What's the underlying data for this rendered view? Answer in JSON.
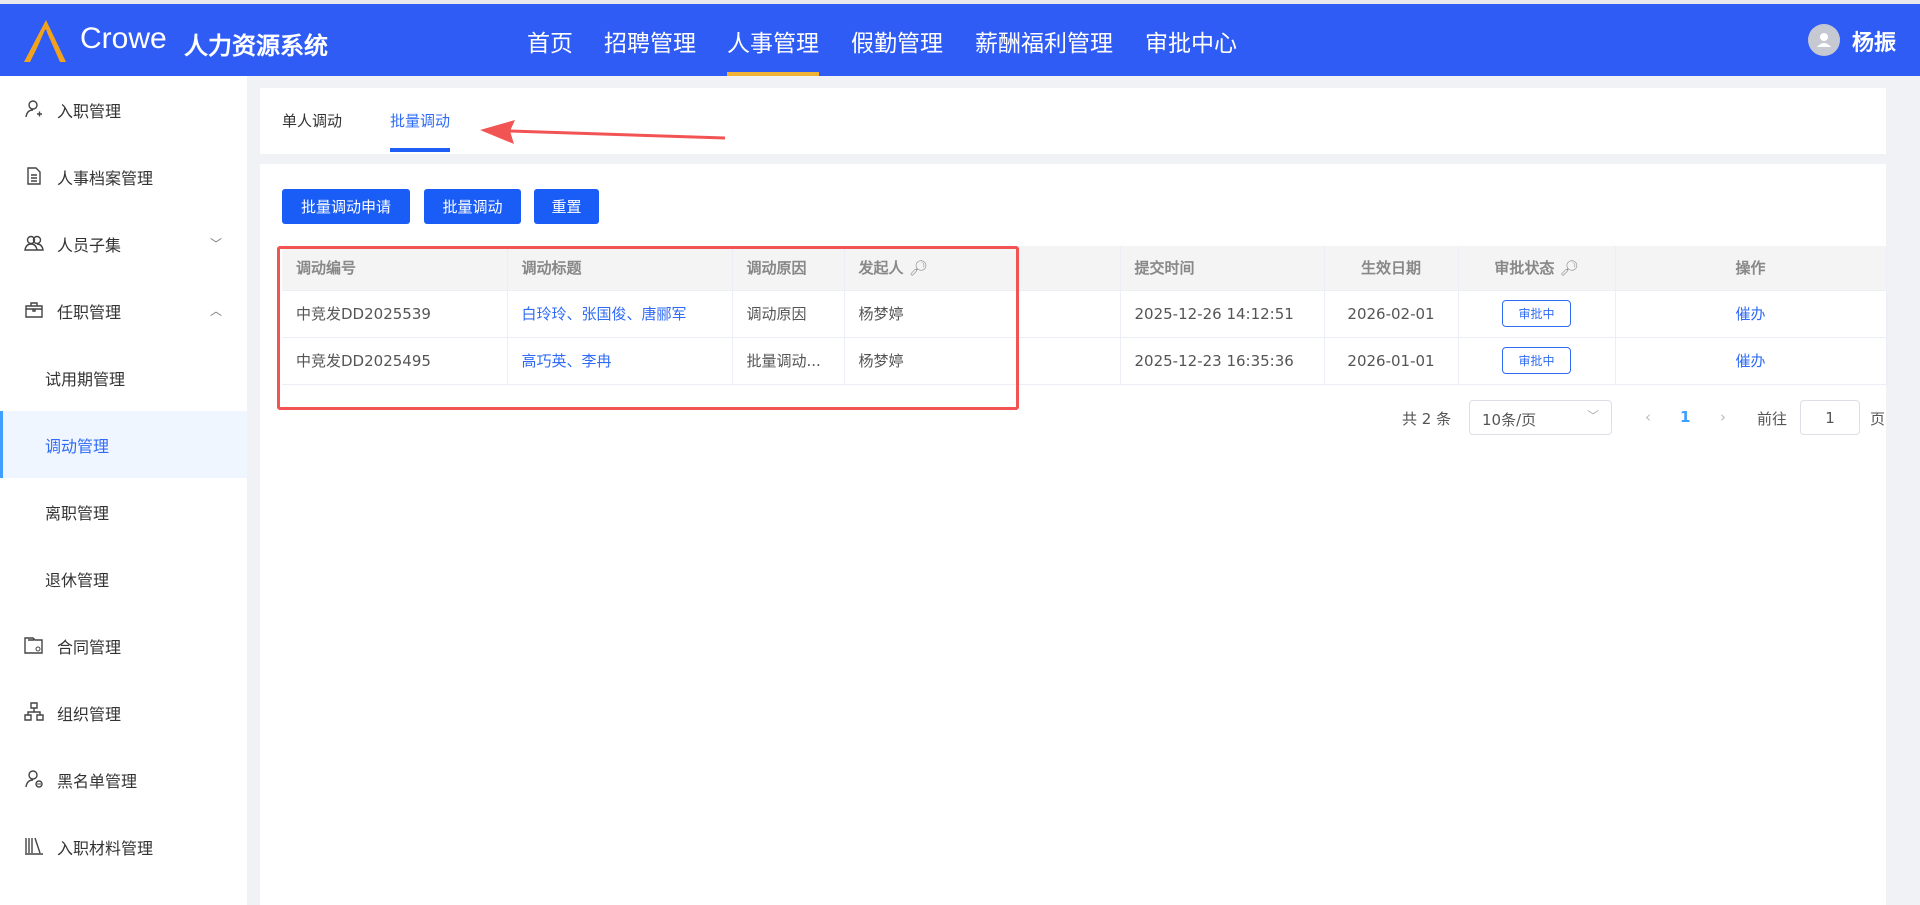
{
  "header": {
    "brand": "Crowe",
    "system": "人力资源系统",
    "nav": [
      "首页",
      "招聘管理",
      "人事管理",
      "假勤管理",
      "薪酬福利管理",
      "审批中心"
    ],
    "active_nav": "人事管理",
    "user": "杨振",
    "accent": "#305cf6"
  },
  "sidebar": {
    "items": [
      {
        "label": "入职管理",
        "icon": "user-add-icon"
      },
      {
        "label": "人事档案管理",
        "icon": "document-icon"
      },
      {
        "label": "人员子集",
        "icon": "users-icon"
      },
      {
        "label": "任职管理",
        "icon": "briefcase-icon"
      },
      {
        "label": "试用期管理"
      },
      {
        "label": "调动管理"
      },
      {
        "label": "离职管理"
      },
      {
        "label": "退休管理"
      },
      {
        "label": "合同管理",
        "icon": "contract-folder-icon"
      },
      {
        "label": "组织管理",
        "icon": "org-chart-icon"
      },
      {
        "label": "黑名单管理",
        "icon": "user-block-icon"
      },
      {
        "label": "入职材料管理",
        "icon": "books-icon"
      }
    ],
    "active": "调动管理"
  },
  "tabs": [
    "单人调动",
    "批量调动"
  ],
  "buttons": [
    "批量调动申请",
    "批量调动",
    "重置"
  ],
  "table": {
    "headers": [
      "调动编号",
      "调动标题",
      "调动原因",
      "发起人",
      "提交时间",
      "生效日期",
      "审批状态",
      "操作"
    ],
    "rows": [
      {
        "id": "中竞发DD2025539",
        "title": "白玲玲、张国俊、唐郦军",
        "reason": "调动原因",
        "initiator": "杨梦婷",
        "submitted": "2025-12-26 14:12:51",
        "effective": "2026-02-01",
        "status": "审批中",
        "action": "催办"
      },
      {
        "id": "中竞发DD2025495",
        "title": "高巧英、李冉",
        "reason": "批量调动...",
        "initiator": "杨梦婷",
        "submitted": "2025-12-23 16:35:36",
        "effective": "2026-01-01",
        "status": "审批中",
        "action": "催办"
      }
    ]
  },
  "pagination": {
    "total": "共 2 条",
    "page_size": "10条/页",
    "current": "1",
    "goto_label": "前往",
    "goto_value": "1",
    "page_suffix": "页"
  }
}
